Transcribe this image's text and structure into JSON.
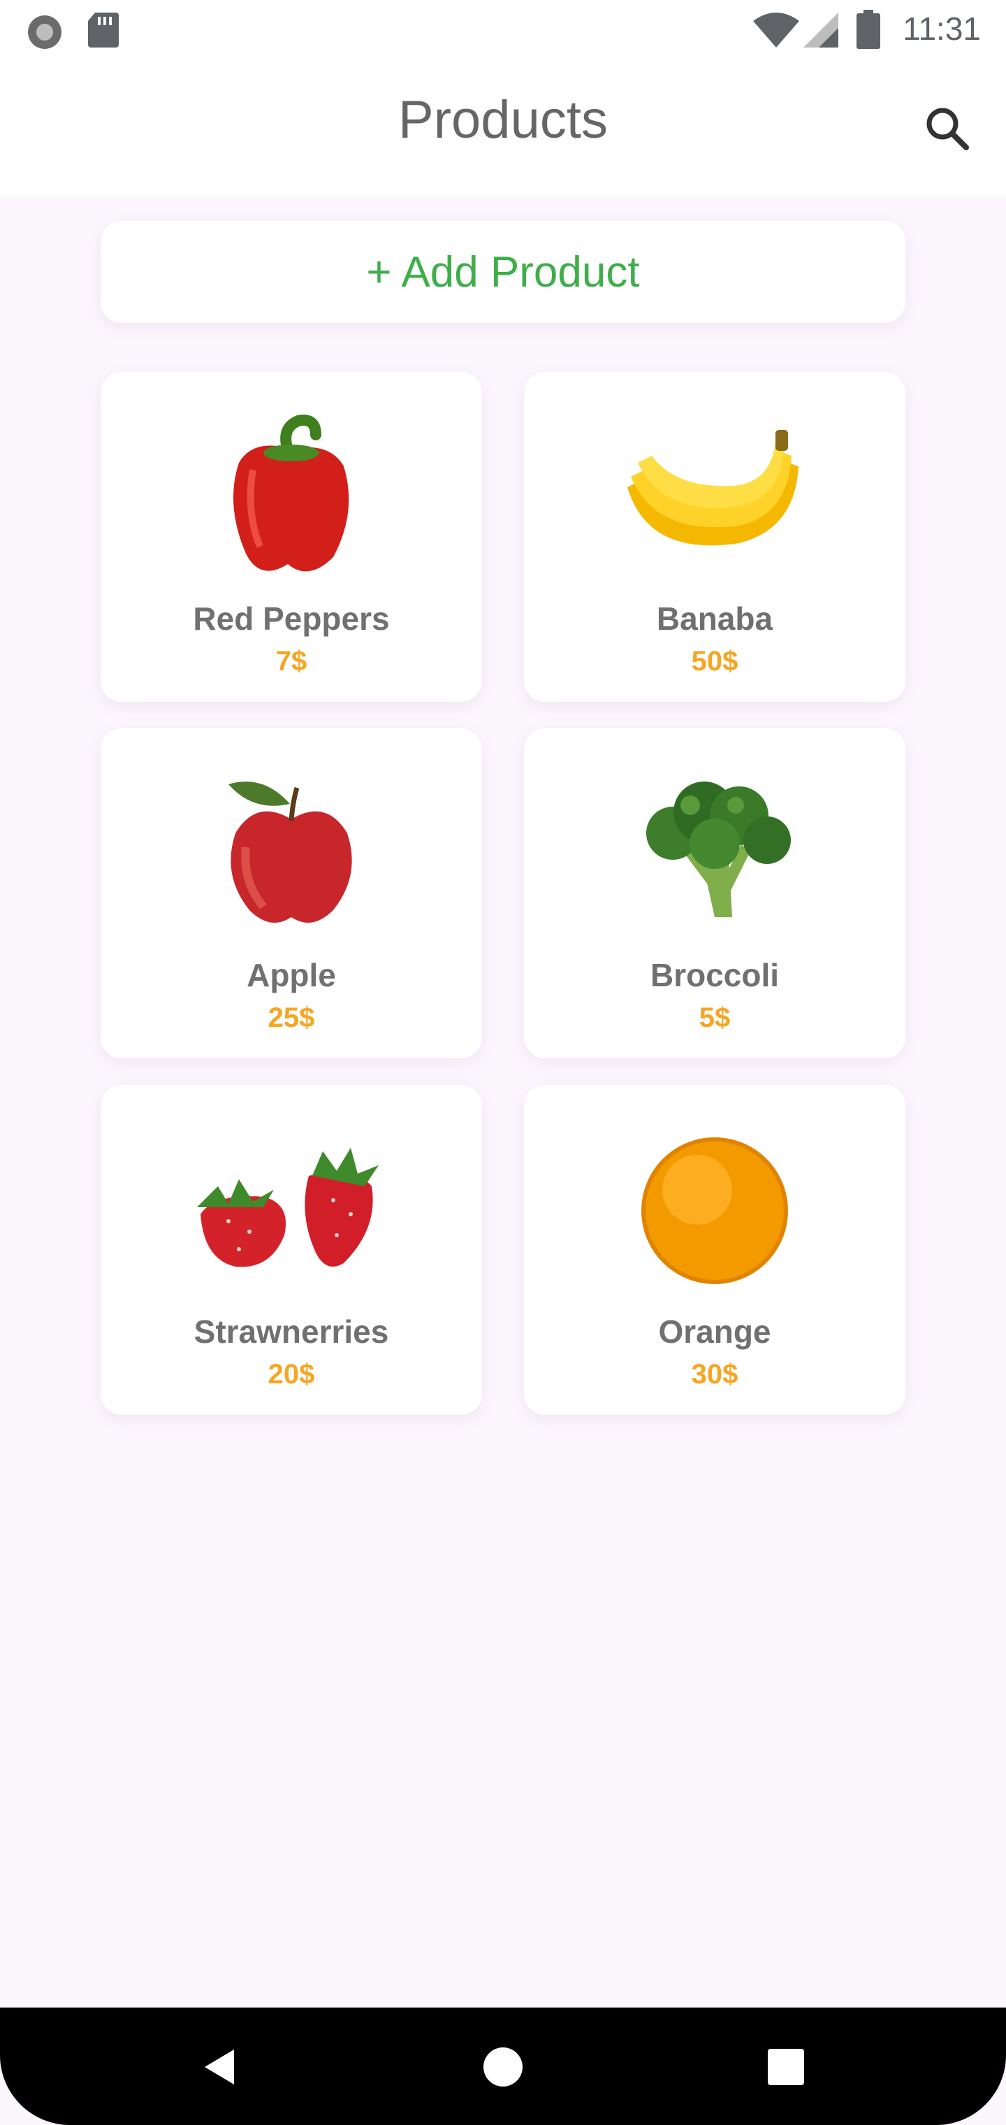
{
  "status_bar": {
    "time": "11:31",
    "icons": [
      "record-icon",
      "sd-card-icon",
      "wifi-icon",
      "signal-icon",
      "battery-icon"
    ]
  },
  "app_bar": {
    "title": "Products",
    "search_icon": "search-icon"
  },
  "add_button": {
    "label": "+ Add Product",
    "color": "#3fae49"
  },
  "products": [
    {
      "name": "Red Peppers",
      "price": "7$",
      "image": "red-pepper"
    },
    {
      "name": "Banaba",
      "price": "50$",
      "image": "banana"
    },
    {
      "name": "Apple",
      "price": "25$",
      "image": "apple"
    },
    {
      "name": "Broccoli",
      "price": "5$",
      "image": "broccoli"
    },
    {
      "name": "Strawnerries",
      "price": "20$",
      "image": "strawberries"
    },
    {
      "name": "Orange",
      "price": "30$",
      "image": "orange"
    }
  ],
  "price_color": "#f5a623",
  "nav_bar": {
    "buttons": [
      "back-icon",
      "home-icon",
      "recents-icon"
    ]
  }
}
